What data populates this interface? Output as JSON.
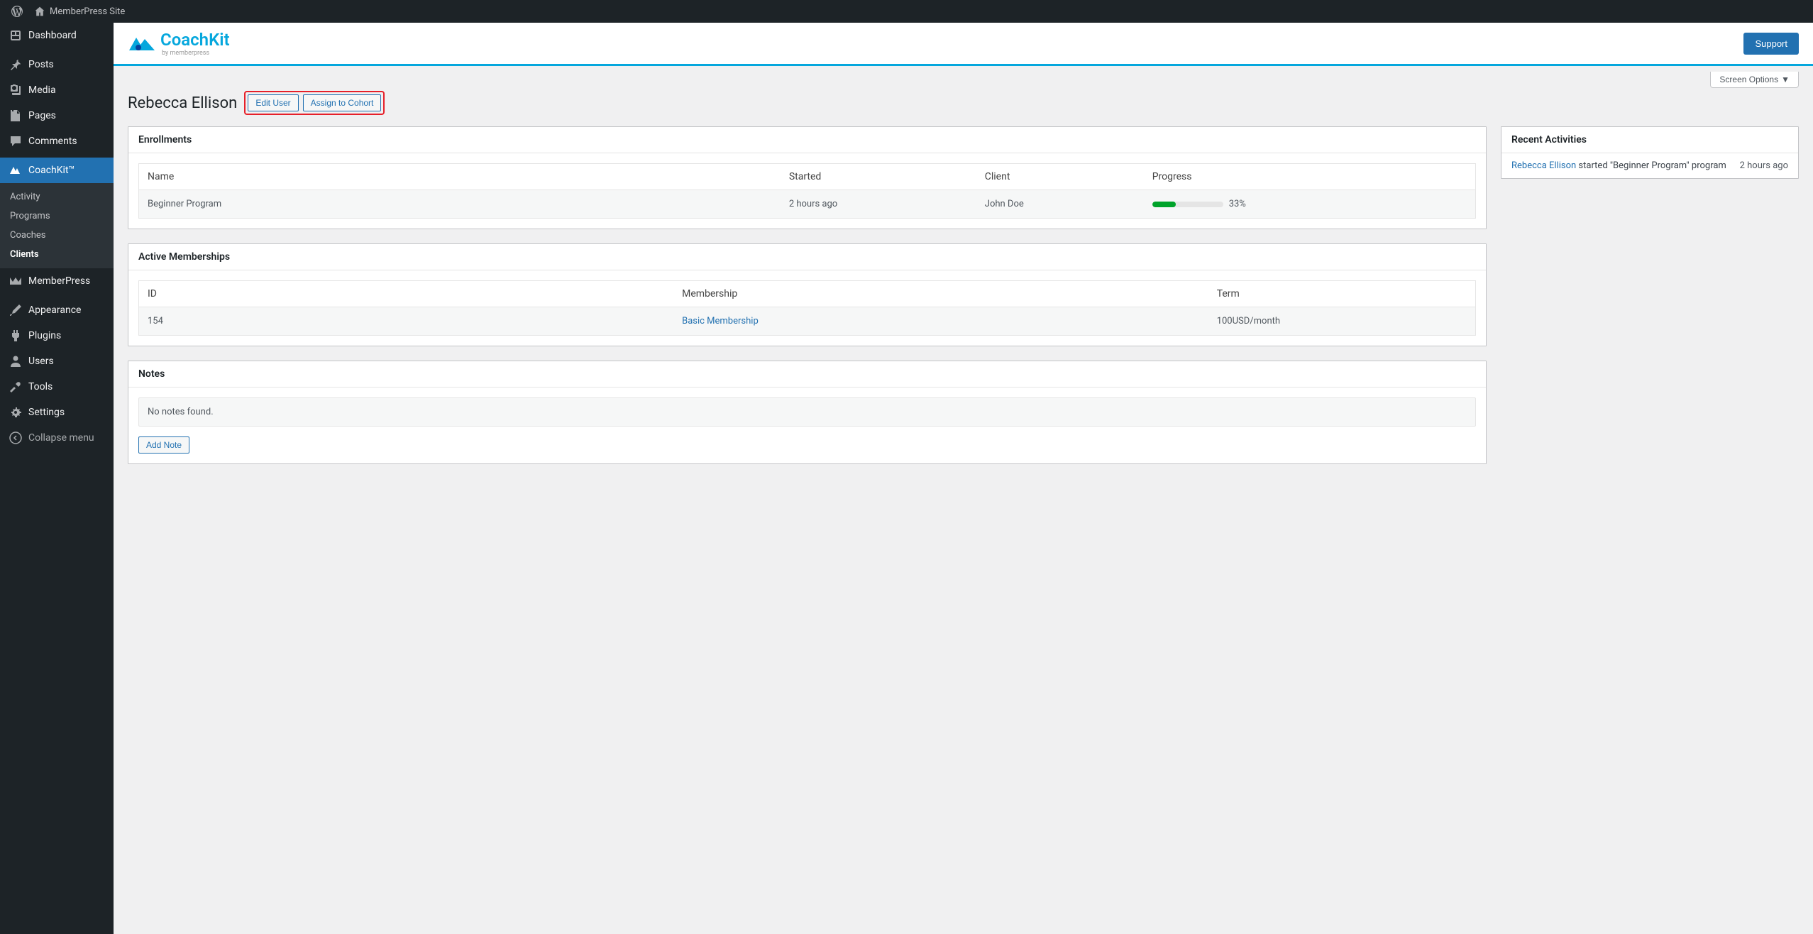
{
  "adminBar": {
    "siteName": "MemberPress Site"
  },
  "sidebar": {
    "dashboard": "Dashboard",
    "posts": "Posts",
    "media": "Media",
    "pages": "Pages",
    "comments": "Comments",
    "coachkit": "CoachKit™",
    "sub": {
      "activity": "Activity",
      "programs": "Programs",
      "coaches": "Coaches",
      "clients": "Clients"
    },
    "memberpress": "MemberPress",
    "appearance": "Appearance",
    "plugins": "Plugins",
    "users": "Users",
    "tools": "Tools",
    "settings": "Settings",
    "collapse": "Collapse menu"
  },
  "brand": {
    "name": "CoachKit",
    "sub": "by memberpress",
    "support": "Support"
  },
  "screenOptions": "Screen Options",
  "page": {
    "title": "Rebecca Ellison",
    "editUser": "Edit User",
    "assign": "Assign to Cohort"
  },
  "enrollments": {
    "title": "Enrollments",
    "cols": {
      "name": "Name",
      "started": "Started",
      "client": "Client",
      "progress": "Progress"
    },
    "row": {
      "name": "Beginner Program",
      "started": "2 hours ago",
      "client": "John Doe",
      "pct": "33%",
      "fill": 33
    }
  },
  "memberships": {
    "title": "Active Memberships",
    "cols": {
      "id": "ID",
      "membership": "Membership",
      "term": "Term"
    },
    "row": {
      "id": "154",
      "membership": "Basic Membership",
      "term": "100USD/month"
    }
  },
  "notes": {
    "title": "Notes",
    "empty": "No notes found.",
    "add": "Add Note"
  },
  "activities": {
    "title": "Recent Activities",
    "row": {
      "user": "Rebecca Ellison",
      "rest": " started \"Beginner Program\" program",
      "time": "2 hours ago"
    }
  }
}
